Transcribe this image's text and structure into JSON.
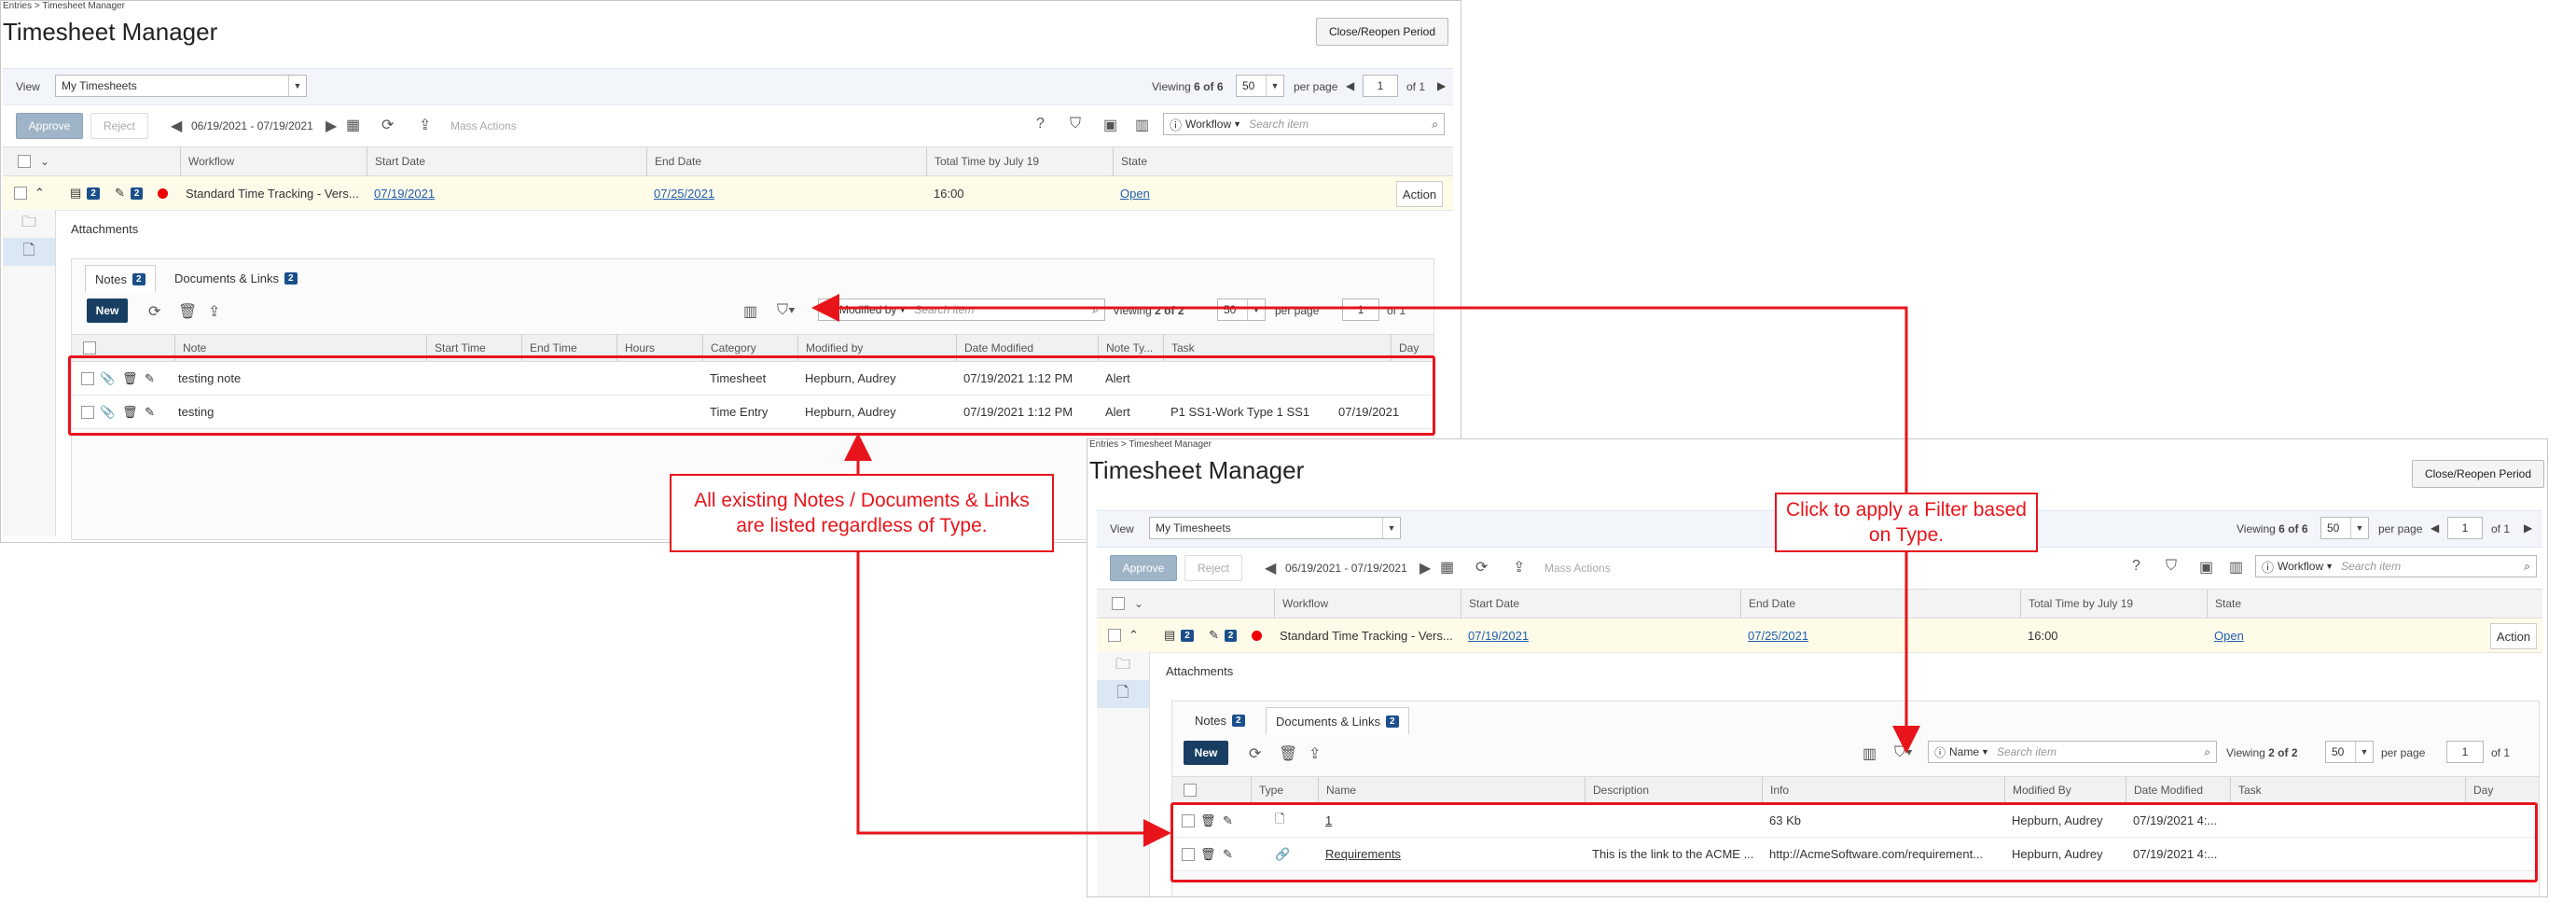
{
  "screens": {
    "top": {
      "breadcrumb": "Entries > Timesheet Manager",
      "title": "Timesheet Manager",
      "close_reopen": "Close/Reopen Period",
      "view_label": "View",
      "view_value": "My Timesheets",
      "viewing": "Viewing",
      "viewing_count": "6 of 6",
      "per_page_value": "50",
      "per_page_label": "per page",
      "page_value": "1",
      "of_pages": "of 1",
      "approve": "Approve",
      "reject": "Reject",
      "date_range": "06/19/2021 - 07/19/2021",
      "mass_actions": "Mass Actions",
      "workflow_dd": "Workflow",
      "search_placeholder": "Search item",
      "columns": [
        "Workflow",
        "Start Date",
        "End Date",
        "Total Time by July 19",
        "State"
      ],
      "row": {
        "badge1": "2",
        "badge2": "2",
        "workflow": "Standard Time Tracking - Vers...",
        "start": "07/19/2021",
        "end": "07/25/2021",
        "total": "16:00",
        "state": "Open",
        "action": "Action"
      },
      "attachments_label": "Attachments",
      "tabs": [
        {
          "label": "Notes",
          "count": "2"
        },
        {
          "label": "Documents & Links",
          "count": "2"
        }
      ],
      "new_button": "New",
      "filter_dd": "Modified by",
      "sub_search_placeholder": "Search item",
      "sub_viewing": "Viewing",
      "sub_viewing_count": "2 of 2",
      "sub_per_page_value": "50",
      "sub_per_page_label": "per page",
      "sub_page_value": "1",
      "sub_of_pages": "of 1",
      "note_columns": [
        "Note",
        "Start Time",
        "End Time",
        "Hours",
        "Category",
        "Modified by",
        "Date Modified",
        "Note Ty...",
        "Task",
        "Day"
      ],
      "notes": [
        {
          "note": "testing note",
          "category": "Timesheet",
          "modified_by": "Hepburn, Audrey",
          "date": "07/19/2021 1:12 PM",
          "type": "Alert",
          "task": "",
          "day": ""
        },
        {
          "note": "testing",
          "category": "Time Entry",
          "modified_by": "Hepburn, Audrey",
          "date": "07/19/2021 1:12 PM",
          "type": "Alert",
          "task": "P1 SS1-Work Type 1 SS1",
          "day": "07/19/2021"
        }
      ]
    },
    "bottom": {
      "breadcrumb": "Entries > Timesheet Manager",
      "title": "Timesheet Manager",
      "close_reopen": "Close/Reopen Period",
      "view_label": "View",
      "view_value": "My Timesheets",
      "viewing": "Viewing",
      "viewing_count": "6 of 6",
      "per_page_value": "50",
      "per_page_label": "per page",
      "page_value": "1",
      "of_pages": "of 1",
      "approve": "Approve",
      "reject": "Reject",
      "date_range": "06/19/2021 - 07/19/2021",
      "mass_actions": "Mass Actions",
      "workflow_dd": "Workflow",
      "search_placeholder": "Search item",
      "columns": [
        "Workflow",
        "Start Date",
        "End Date",
        "Total Time by July 19",
        "State"
      ],
      "row": {
        "badge1": "2",
        "badge2": "2",
        "workflow": "Standard Time Tracking - Vers...",
        "start": "07/19/2021",
        "end": "07/25/2021",
        "total": "16:00",
        "state": "Open",
        "action": "Action"
      },
      "attachments_label": "Attachments",
      "tabs": [
        {
          "label": "Notes",
          "count": "2"
        },
        {
          "label": "Documents & Links",
          "count": "2"
        }
      ],
      "new_button": "New",
      "filter_dd": "Name",
      "sub_search_placeholder": "Search item",
      "sub_viewing": "Viewing",
      "sub_viewing_count": "2 of 2",
      "sub_per_page_value": "50",
      "sub_per_page_label": "per page",
      "sub_page_value": "1",
      "sub_of_pages": "of 1",
      "doc_columns": [
        "Type",
        "Name",
        "Description",
        "Info",
        "Modified By",
        "Date Modified",
        "Task",
        "Day"
      ],
      "docs": [
        {
          "name": "1",
          "description": "",
          "info": "63 Kb",
          "modified_by": "Hepburn, Audrey",
          "date": "07/19/2021 4:..."
        },
        {
          "name": "Requirements",
          "description": "This is the link to the ACME ...",
          "info": "http://AcmeSoftware.com/requirement...",
          "modified_by": "Hepburn, Audrey",
          "date": "07/19/2021 4:..."
        }
      ]
    }
  },
  "callouts": {
    "left": "All existing Notes / Documents & Links are listed regardless of Type.",
    "right": "Click to apply a Filter based on Type."
  },
  "colors": {
    "annotation": "#e8141b",
    "badge": "#1b4f8c",
    "new_button": "#183f63",
    "link": "#1f5fb0"
  }
}
